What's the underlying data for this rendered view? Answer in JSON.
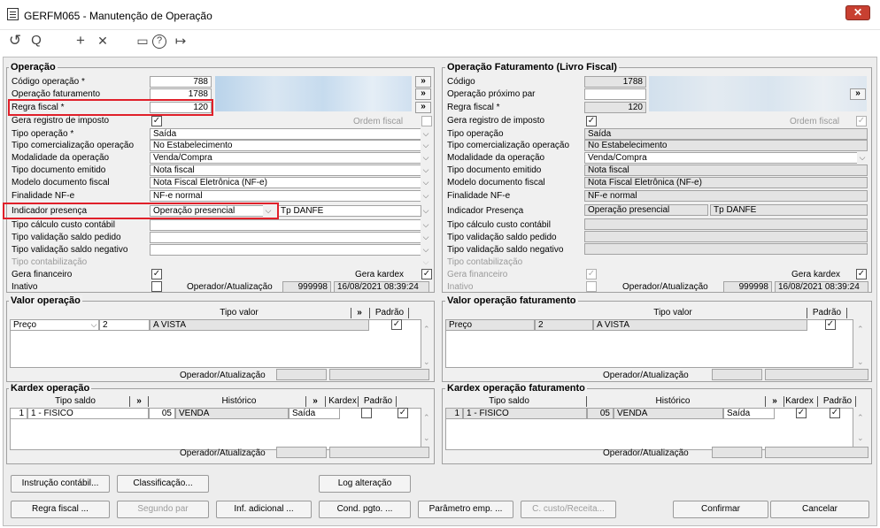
{
  "window": {
    "title": "GERFM065 - Manutenção de Operação",
    "close": "✕"
  },
  "toolbar": {
    "refresh": "↺",
    "search": "Q",
    "add": "+",
    "remove": "✕",
    "calendar": "▭",
    "help": "?",
    "exit": "↦"
  },
  "left": {
    "title": "Operação",
    "labels": {
      "codigo": "Código operação *",
      "opfat": "Operação faturamento",
      "regra": "Regra fiscal *",
      "gera_reg": "Gera registro de imposto",
      "ordem": "Ordem fiscal",
      "tipo_op": "Tipo operação *",
      "tipo_com": "Tipo comercialização operação",
      "modalidade": "Modalidade da operação",
      "tipo_doc": "Tipo documento emitido",
      "modelo": "Modelo documento fiscal",
      "finalidade": "Finalidade NF-e",
      "indicador": "Indicador presença",
      "tipo_calc": "Tipo cálculo custo contábil",
      "tipo_val_ped": "Tipo validação saldo pedido",
      "tipo_val_neg": "Tipo validação saldo negativo",
      "tipo_cont": "Tipo contabilização",
      "gera_fin": "Gera financeiro",
      "gera_kardex": "Gera kardex",
      "inativo": "Inativo",
      "operador": "Operador/Atualização",
      "tp_danfe": "Tp DANFE"
    },
    "values": {
      "codigo": "788",
      "opfat": "1788",
      "regra": "120",
      "tipo_op": "Saída",
      "tipo_com": "No Estabelecimento",
      "modalidade": "Venda/Compra",
      "tipo_doc": "Nota fiscal",
      "modelo": "Nota Fiscal Eletrônica (NF-e)",
      "finalidade": "NF-e normal",
      "indicador": "Operação presencial",
      "operador": "999998",
      "data": "16/08/2021 08:39:24"
    },
    "lookup": "»"
  },
  "right": {
    "title": "Operação Faturamento (Livro Fiscal)",
    "labels": {
      "codigo": "Código",
      "opprox": "Operação próximo par",
      "regra": "Regra fiscal *",
      "gera_reg": "Gera registro de imposto",
      "ordem": "Ordem fiscal",
      "tipo_op": "Tipo operação",
      "tipo_com": "Tipo comercialização operação",
      "modalidade": "Modalidade da operação",
      "tipo_doc": "Tipo documento emitido",
      "modelo": "Modelo documento fiscal",
      "finalidade": "Finalidade NF-e",
      "indicador": "Indicador Presença",
      "tipo_calc": "Tipo cálculo custo contábil",
      "tipo_val_ped": "Tipo validação saldo pedido",
      "tipo_val_neg": "Tipo validação saldo negativo",
      "tipo_cont": "Tipo contabilização",
      "gera_fin": "Gera financeiro",
      "gera_kardex": "Gera kardex",
      "inativo": "Inativo",
      "operador": "Operador/Atualização",
      "tp_danfe": "Tp DANFE"
    },
    "values": {
      "codigo": "1788",
      "regra": "120",
      "tipo_op": "Saída",
      "tipo_com": "No Estabelecimento",
      "modalidade": "Venda/Compra",
      "tipo_doc": "Nota fiscal",
      "modelo": "Nota Fiscal Eletrônica (NF-e)",
      "finalidade": "NF-e normal",
      "indicador": "Operação presencial",
      "operador": "999998",
      "data": "16/08/2021 08:39:24"
    }
  },
  "valor": {
    "title_left": "Valor operação",
    "title_right": "Valor operação faturamento",
    "tipo_valor": "Tipo valor",
    "padrao": "Padrão",
    "row_name": "Preço",
    "row_num": "2",
    "row_desc": "A VISTA",
    "operador": "Operador/Atualização"
  },
  "kardex": {
    "title_left": "Kardex operação",
    "title_right": "Kardex operação faturamento",
    "tipo_saldo": "Tipo saldo",
    "historico": "Histórico",
    "kardex": "Kardex",
    "padrao": "Padrão",
    "num": "1",
    "saldo": "1 - FISICO",
    "hist_code": "05",
    "hist": "VENDA",
    "tipo": "Saída",
    "operador": "Operador/Atualização"
  },
  "buttons": {
    "instrucao": "Instrução contábil...",
    "classificacao": "Classificação...",
    "log": "Log alteração",
    "regra": "Regra fiscal ...",
    "segundo": "Segundo par",
    "inf": "Inf. adicional ...",
    "cond": "Cond. pgto. ...",
    "parametro": "Parâmetro emp. ...",
    "ccusto": "C. custo/Receita...",
    "confirmar": "Confirmar",
    "cancelar": "Cancelar"
  }
}
